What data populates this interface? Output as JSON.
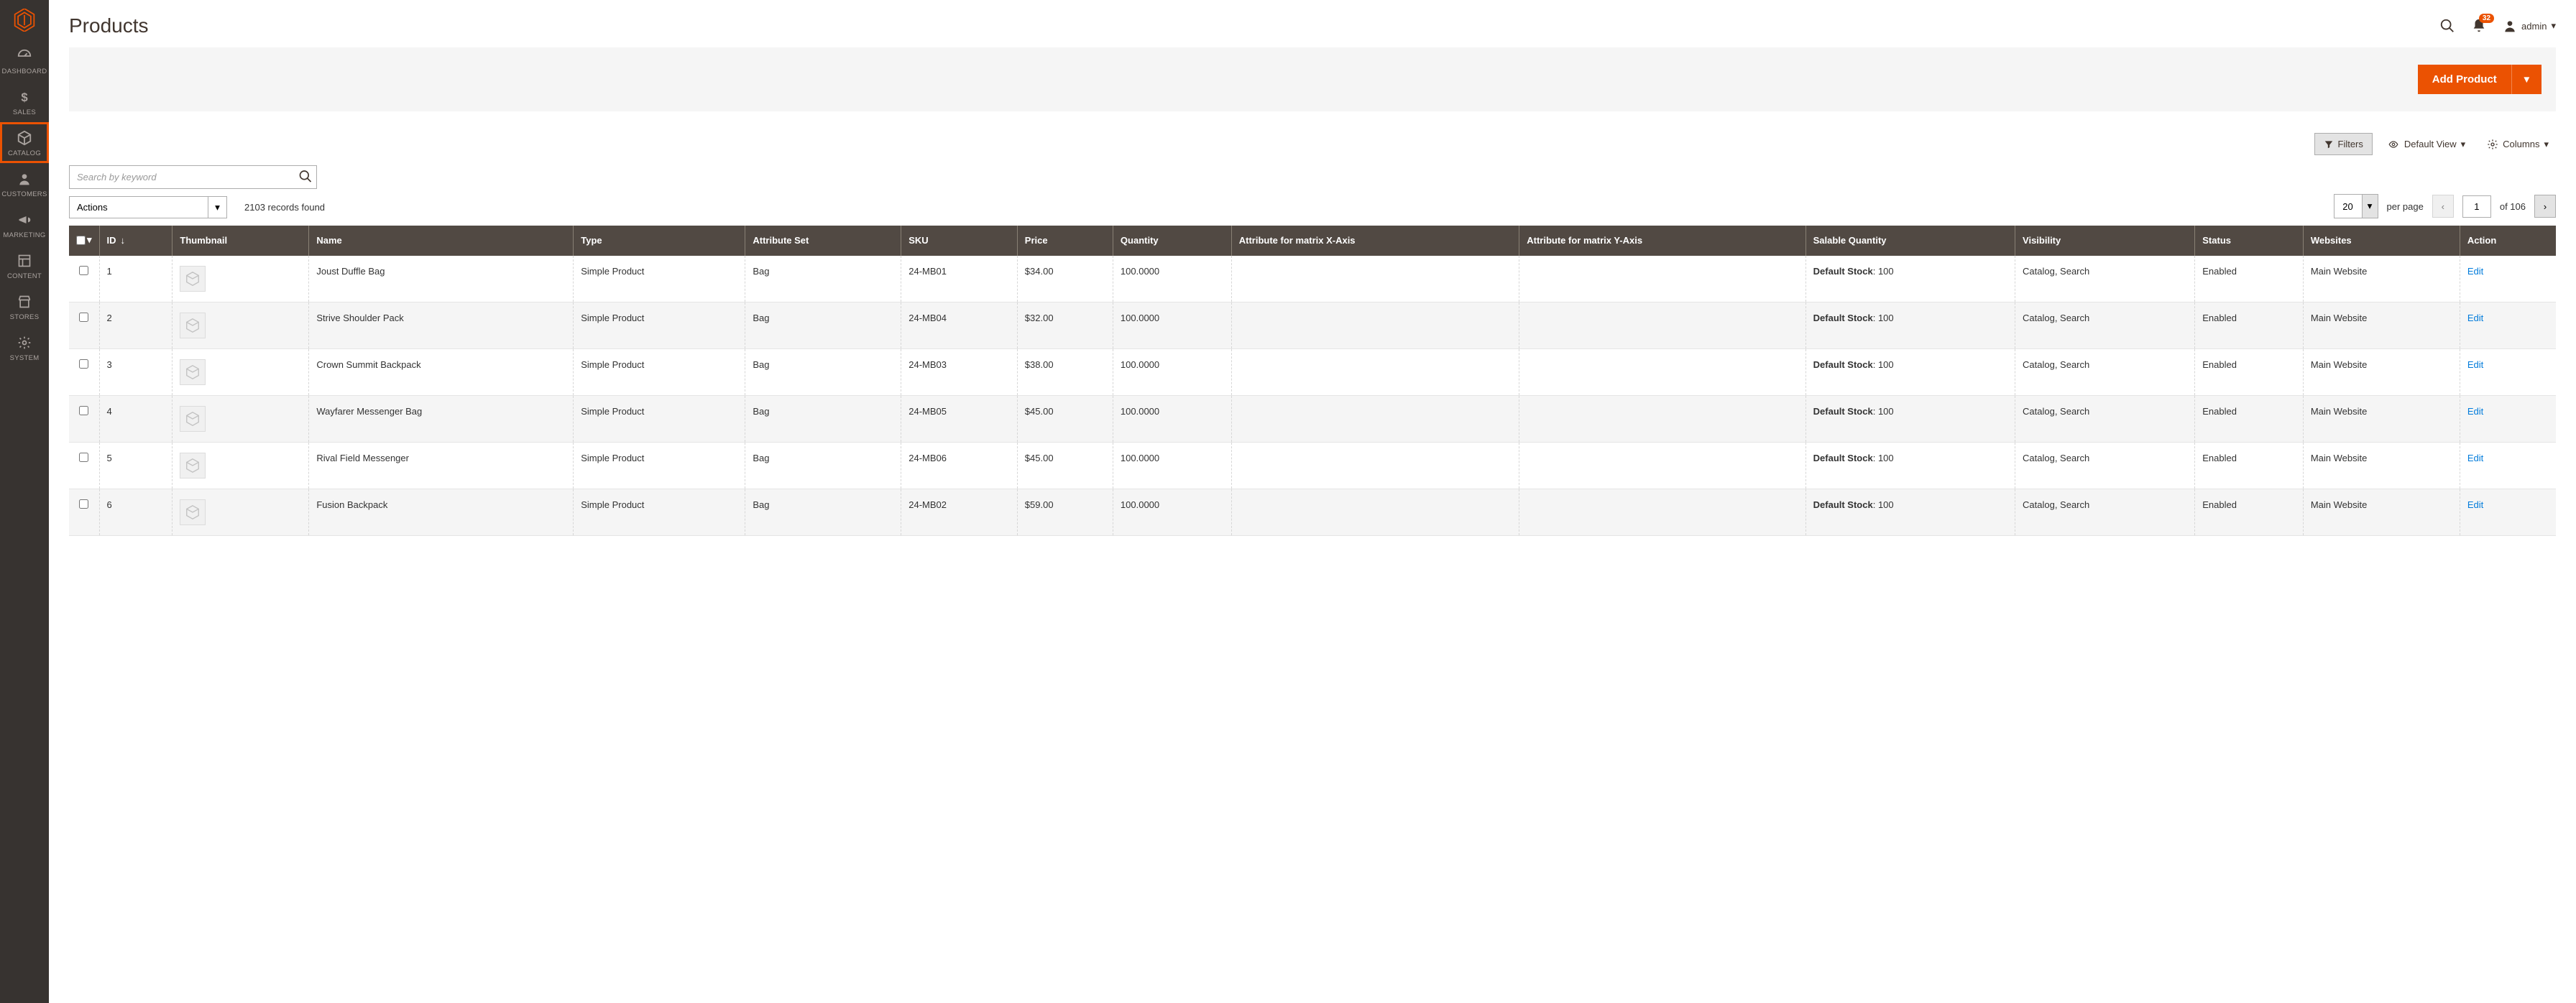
{
  "sidebar": {
    "items": [
      {
        "label": "DASHBOARD",
        "name": "sidebar-item-dashboard"
      },
      {
        "label": "SALES",
        "name": "sidebar-item-sales"
      },
      {
        "label": "CATALOG",
        "name": "sidebar-item-catalog"
      },
      {
        "label": "CUSTOMERS",
        "name": "sidebar-item-customers"
      },
      {
        "label": "MARKETING",
        "name": "sidebar-item-marketing"
      },
      {
        "label": "CONTENT",
        "name": "sidebar-item-content"
      },
      {
        "label": "STORES",
        "name": "sidebar-item-stores"
      },
      {
        "label": "SYSTEM",
        "name": "sidebar-item-system"
      }
    ]
  },
  "header": {
    "title": "Products",
    "notifications_count": "32",
    "user_label": "admin"
  },
  "action_bar": {
    "add_product_label": "Add Product"
  },
  "toolbar": {
    "filters_label": "Filters",
    "default_view_label": "Default View",
    "columns_label": "Columns",
    "search_placeholder": "Search by keyword",
    "actions_label": "Actions",
    "records_found": "2103 records found",
    "per_page_value": "20",
    "per_page_label": "per page",
    "page_value": "1",
    "of_pages": "of 106"
  },
  "columns": {
    "id": "ID",
    "thumbnail": "Thumbnail",
    "name": "Name",
    "type": "Type",
    "attribute_set": "Attribute Set",
    "sku": "SKU",
    "price": "Price",
    "quantity": "Quantity",
    "attr_x": "Attribute for matrix X-Axis",
    "attr_y": "Attribute for matrix Y-Axis",
    "salable": "Salable Quantity",
    "visibility": "Visibility",
    "status": "Status",
    "websites": "Websites",
    "action": "Action"
  },
  "salable_label": "Default Stock",
  "edit_label": "Edit",
  "rows": [
    {
      "id": "1",
      "name": "Joust Duffle Bag",
      "type": "Simple Product",
      "attribute_set": "Bag",
      "sku": "24-MB01",
      "price": "$34.00",
      "quantity": "100.0000",
      "attr_x": "",
      "attr_y": "",
      "salable_qty": "100",
      "visibility": "Catalog, Search",
      "status": "Enabled",
      "websites": "Main Website"
    },
    {
      "id": "2",
      "name": "Strive Shoulder Pack",
      "type": "Simple Product",
      "attribute_set": "Bag",
      "sku": "24-MB04",
      "price": "$32.00",
      "quantity": "100.0000",
      "attr_x": "",
      "attr_y": "",
      "salable_qty": "100",
      "visibility": "Catalog, Search",
      "status": "Enabled",
      "websites": "Main Website"
    },
    {
      "id": "3",
      "name": "Crown Summit Backpack",
      "type": "Simple Product",
      "attribute_set": "Bag",
      "sku": "24-MB03",
      "price": "$38.00",
      "quantity": "100.0000",
      "attr_x": "",
      "attr_y": "",
      "salable_qty": "100",
      "visibility": "Catalog, Search",
      "status": "Enabled",
      "websites": "Main Website"
    },
    {
      "id": "4",
      "name": "Wayfarer Messenger Bag",
      "type": "Simple Product",
      "attribute_set": "Bag",
      "sku": "24-MB05",
      "price": "$45.00",
      "quantity": "100.0000",
      "attr_x": "",
      "attr_y": "",
      "salable_qty": "100",
      "visibility": "Catalog, Search",
      "status": "Enabled",
      "websites": "Main Website"
    },
    {
      "id": "5",
      "name": "Rival Field Messenger",
      "type": "Simple Product",
      "attribute_set": "Bag",
      "sku": "24-MB06",
      "price": "$45.00",
      "quantity": "100.0000",
      "attr_x": "",
      "attr_y": "",
      "salable_qty": "100",
      "visibility": "Catalog, Search",
      "status": "Enabled",
      "websites": "Main Website"
    },
    {
      "id": "6",
      "name": "Fusion Backpack",
      "type": "Simple Product",
      "attribute_set": "Bag",
      "sku": "24-MB02",
      "price": "$59.00",
      "quantity": "100.0000",
      "attr_x": "",
      "attr_y": "",
      "salable_qty": "100",
      "visibility": "Catalog, Search",
      "status": "Enabled",
      "websites": "Main Website"
    }
  ]
}
